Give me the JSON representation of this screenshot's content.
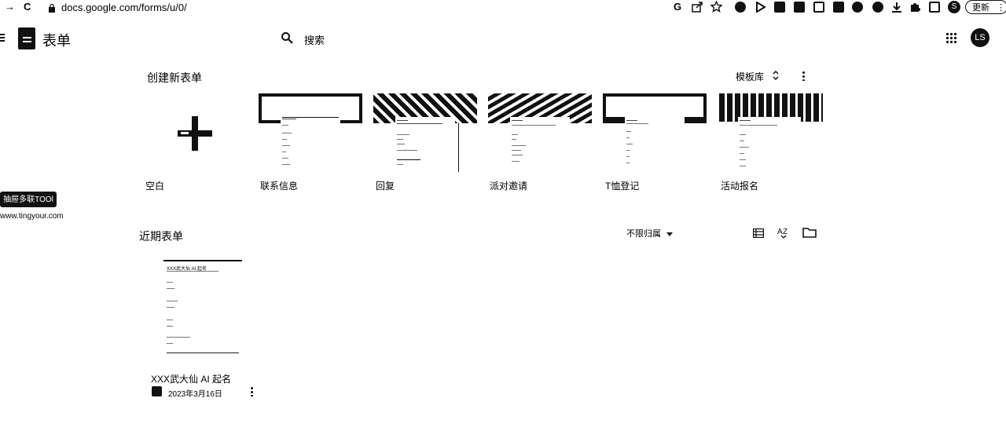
{
  "browser": {
    "url": "docs.google.com/forms/u/0/",
    "back_glyph": "→",
    "reload_glyph": "C",
    "google_glyph": "G",
    "profile_letter": "S",
    "update_label": "更新",
    "update_menu": "⋮"
  },
  "app": {
    "title": "表单",
    "search_label": "搜索",
    "account_initials": "LS"
  },
  "new_form": {
    "heading": "创建新表单",
    "template_gallery": "模板库",
    "templates": [
      {
        "label": "空白"
      },
      {
        "label": "联系信息"
      },
      {
        "label": "回复"
      },
      {
        "label": "派对邀请"
      },
      {
        "label": "T恤登记"
      },
      {
        "label": "活动报名"
      }
    ]
  },
  "watermark": {
    "badge": "抽屉多联TOOl",
    "url": "www.tingyour.com"
  },
  "recent": {
    "heading": "近期表单",
    "owner_filter": "不限归属",
    "items": [
      {
        "title": "XXX武大仙 AI 起名",
        "date": "2023年3月16日",
        "thumb_title": "XXX武大仙 AI 起名"
      }
    ]
  },
  "icons": {
    "search": "search-icon",
    "apps": "apps-grid-icon",
    "list_view": "list-view-icon",
    "sort": "sort-az-icon",
    "folder": "folder-icon",
    "menu": "menu-icon"
  }
}
